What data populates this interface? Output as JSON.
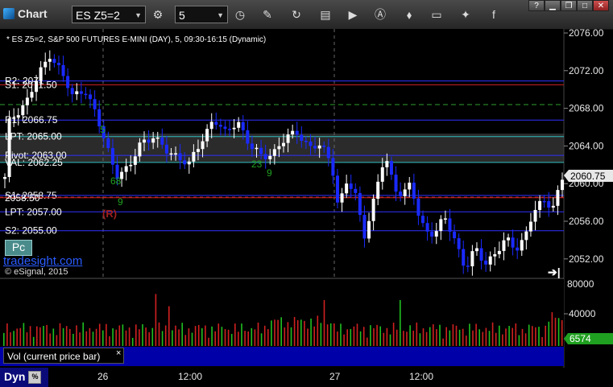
{
  "window": {
    "title": "Chart",
    "symbol": "ES Z5=2",
    "interval": "5",
    "controls": {
      "minimize": "▁",
      "restore": "❐",
      "maximize": "□",
      "close": "✕"
    }
  },
  "toolbar_icons": [
    "gear-icon",
    "clock-icon",
    "pencil-icon",
    "refresh-icon",
    "get-icon",
    "play-icon",
    "alert-icon",
    "link-icon",
    "chat-icon",
    "twitter-icon",
    "facebook-icon"
  ],
  "chart": {
    "header": "* ES Z5=2, S&P 500 FUTURES E-MINI (DAY), 5, 09:30-16:15 (Dynamic)",
    "current_price": "2060.75",
    "price_axis": [
      "2076.00",
      "2072.00",
      "2068.00",
      "2064.00",
      "2060.00",
      "2056.00",
      "2052.00"
    ],
    "volume_axis": [
      "80000",
      "40000"
    ],
    "current_volume": "6574",
    "time_axis": [
      "26",
      "12:00",
      "27",
      "12:00"
    ],
    "levels": [
      {
        "label": "R2: 2071",
        "price": 2070.9,
        "color": "#3030ff"
      },
      {
        "label": "S1: 2071.50",
        "price": 2070.5,
        "color": "#d02020"
      },
      {
        "label": "R1: 2066.75",
        "price": 2066.75,
        "color": "#3030ff"
      },
      {
        "label": "LPT: 2065.00",
        "price": 2065.0,
        "color": "#30c0c0"
      },
      {
        "label": "Pivot: 2063.00",
        "price": 2063.0,
        "color": "#3030ff"
      },
      {
        "label": "VAL: 2062.25",
        "price": 2062.25,
        "color": "#30c0c0"
      },
      {
        "label": "S1: 2058.75",
        "price": 2058.75,
        "color": "#3030ff"
      },
      {
        "label": "2058.50",
        "price": 2058.5,
        "color": "#d02020"
      },
      {
        "label": "LPT: 2057.00",
        "price": 2057.0,
        "color": "#3030ff"
      },
      {
        "label": "S2: 2055.00",
        "price": 2055.0,
        "color": "#3030ff"
      }
    ],
    "annotations": {
      "r_marker": "(R)",
      "nine_a": "9",
      "nine_b": "9",
      "num_68": "68",
      "num_5": "5",
      "num_23": "23"
    }
  },
  "overlays": {
    "pc_button": "Pc",
    "tradesight": "tradesight.com",
    "esignal": "© eSignal, 2015",
    "volume_label": "Vol (current price bar)",
    "volume_close": "×",
    "dyn": "Dyn",
    "dyn_icon": "%"
  },
  "colors": {
    "up_bar": "#ffffff",
    "down_bar": "#1a2aff",
    "volume_down": "#d02020",
    "volume_up": "#20c020",
    "price_tag": "#e8e8e8",
    "volume_tag": "#20a020"
  }
}
